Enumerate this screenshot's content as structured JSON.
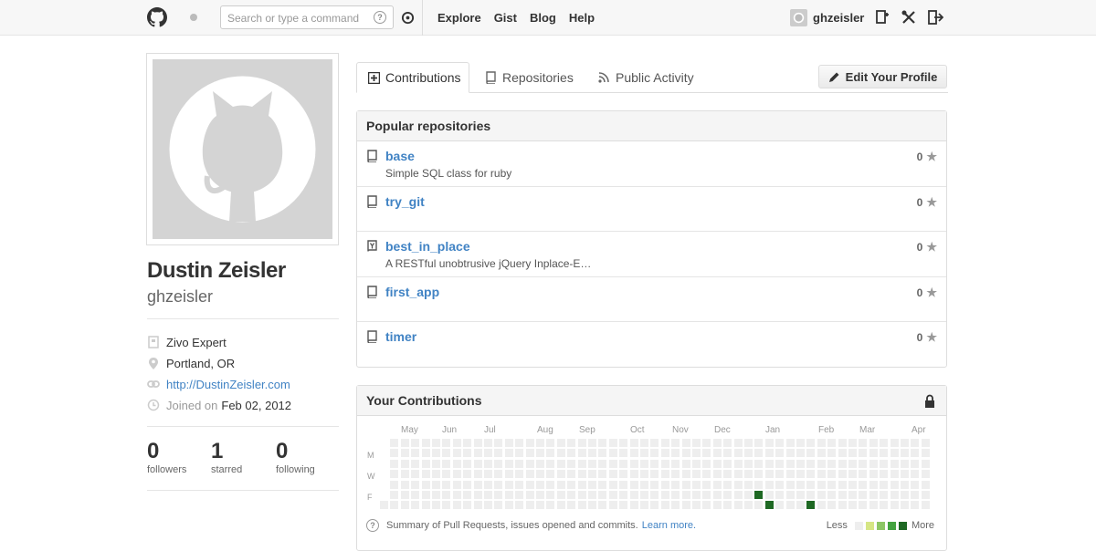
{
  "header": {
    "search_placeholder": "Search or type a command",
    "nav": [
      "Explore",
      "Gist",
      "Blog",
      "Help"
    ],
    "username": "ghzeisler",
    "help_glyph": "?"
  },
  "profile": {
    "fullname": "Dustin Zeisler",
    "username": "ghzeisler",
    "company": "Zivo Expert",
    "location": "Portland, OR",
    "website": "http://DustinZeisler.com",
    "joined_label": "Joined on",
    "joined_date": "Feb 02, 2012",
    "stats": [
      {
        "value": "0",
        "label": "followers"
      },
      {
        "value": "1",
        "label": "starred"
      },
      {
        "value": "0",
        "label": "following"
      }
    ]
  },
  "tabs": [
    {
      "label": "Contributions",
      "icon": "contributions-icon",
      "active": true
    },
    {
      "label": "Repositories",
      "icon": "repo-icon",
      "active": false
    },
    {
      "label": "Public Activity",
      "icon": "rss-icon",
      "active": false
    }
  ],
  "edit_profile_label": "Edit Your Profile",
  "popular": {
    "title": "Popular repositories",
    "repos": [
      {
        "name": "base",
        "desc": "Simple SQL class for ruby",
        "stars": "0",
        "forked": false
      },
      {
        "name": "try_git",
        "desc": "",
        "stars": "0",
        "forked": false
      },
      {
        "name": "best_in_place",
        "desc": "A RESTful unobtrusive jQuery Inplace-E…",
        "stars": "0",
        "forked": true
      },
      {
        "name": "first_app",
        "desc": "",
        "stars": "0",
        "forked": false
      },
      {
        "name": "timer",
        "desc": "",
        "stars": "0",
        "forked": false
      }
    ]
  },
  "contributions": {
    "title": "Your Contributions",
    "months": [
      "May",
      "Jun",
      "Jul",
      "Aug",
      "Sep",
      "Oct",
      "Nov",
      "Dec",
      "Jan",
      "Feb",
      "Mar",
      "Apr"
    ],
    "days": [
      "M",
      "W",
      "F"
    ],
    "summary": "Summary of Pull Requests, issues opened and commits.",
    "learn_more": "Learn more.",
    "less": "Less",
    "more": "More",
    "colors": [
      "#eeeeee",
      "#d6e685",
      "#8cc665",
      "#44a340",
      "#1e6823"
    ],
    "active_cells": [
      {
        "week": 36,
        "day": 5
      },
      {
        "week": 37,
        "day": 6
      },
      {
        "week": 41,
        "day": 6
      }
    ]
  }
}
